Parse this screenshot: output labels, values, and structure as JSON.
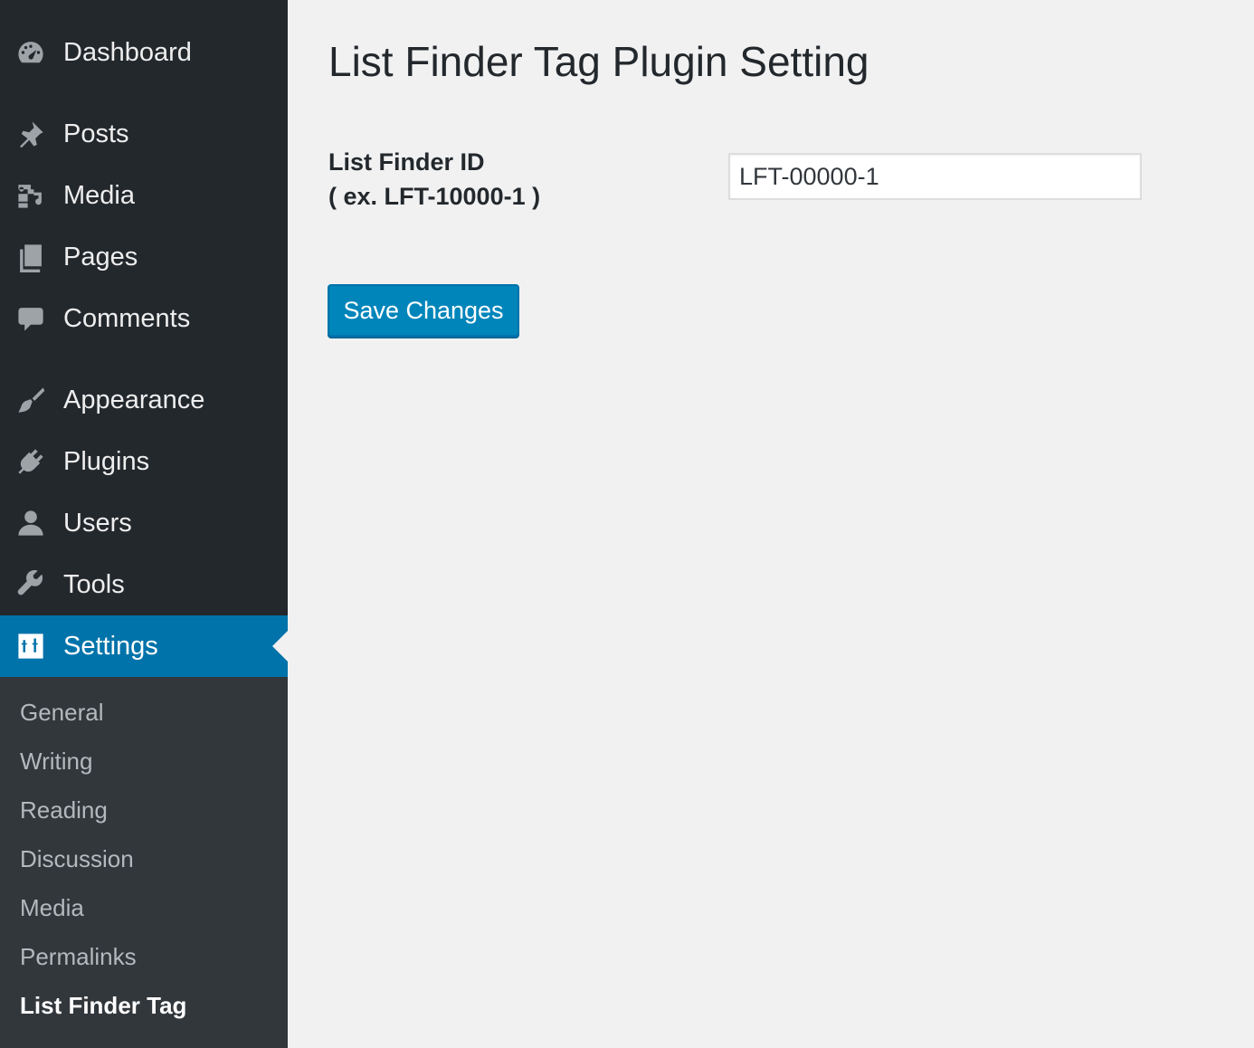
{
  "sidebar": {
    "items": [
      {
        "label": "Dashboard",
        "icon": "dashboard-icon"
      },
      {
        "label": "Posts",
        "icon": "pin-icon"
      },
      {
        "label": "Media",
        "icon": "media-icon"
      },
      {
        "label": "Pages",
        "icon": "pages-icon"
      },
      {
        "label": "Comments",
        "icon": "comment-icon"
      },
      {
        "label": "Appearance",
        "icon": "paintbrush-icon"
      },
      {
        "label": "Plugins",
        "icon": "plugin-icon"
      },
      {
        "label": "Users",
        "icon": "user-icon"
      },
      {
        "label": "Tools",
        "icon": "wrench-icon"
      },
      {
        "label": "Settings",
        "icon": "settings-icon",
        "active": true
      }
    ],
    "submenu": [
      {
        "label": "General"
      },
      {
        "label": "Writing"
      },
      {
        "label": "Reading"
      },
      {
        "label": "Discussion"
      },
      {
        "label": "Media"
      },
      {
        "label": "Permalinks"
      },
      {
        "label": "List Finder Tag",
        "current": true
      }
    ]
  },
  "main": {
    "title": "List Finder Tag Plugin Setting",
    "field": {
      "label_line1": "List Finder ID",
      "label_line2": "( ex. LFT-10000-1 )",
      "value": "LFT-00000-1"
    },
    "save_label": "Save Changes"
  },
  "colors": {
    "sidebar_bg": "#23282d",
    "submenu_bg": "#32373c",
    "accent": "#0073aa",
    "button": "#0085ba",
    "page_bg": "#f1f1f1"
  }
}
